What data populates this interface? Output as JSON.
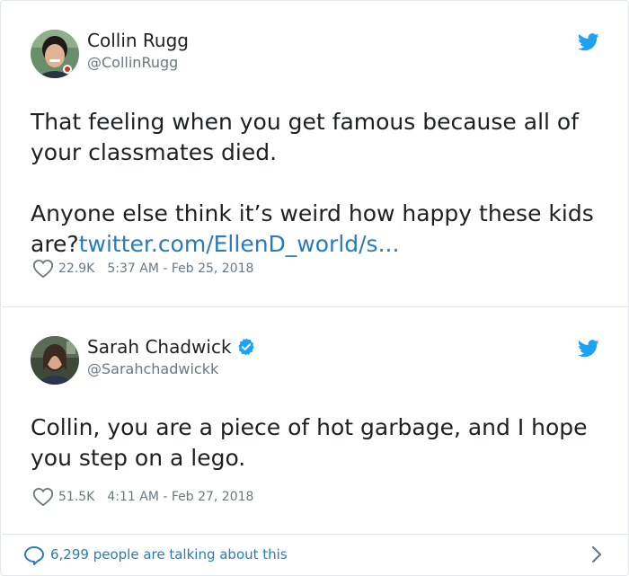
{
  "tweets": [
    {
      "name": "Collin Rugg",
      "handle": "@CollinRugg",
      "verified": false,
      "text_part1": "That feeling when you get famous because all of your classmates died.\n\nAnyone else think it’s weird how happy these kids are?",
      "link": "twitter.com/EllenD_world/s...",
      "likes": "22.9K",
      "timestamp": "5:37 AM - Feb 25, 2018"
    },
    {
      "name": "Sarah Chadwick",
      "handle": "@Sarahchadwickk",
      "verified": true,
      "text_part1": "Collin, you are a piece of hot garbage, and I hope you step on a lego.",
      "likes": "51.5K",
      "timestamp": "4:11 AM - Feb 27, 2018"
    }
  ],
  "footer": {
    "talking_text": "6,299 people are talking about this"
  },
  "colors": {
    "twitter_blue": "#1da1f2",
    "link_blue": "#2b7bb9",
    "meta_gray": "#697882",
    "text_dark": "#1c2022",
    "border": "#e1e8ed"
  },
  "icons": {
    "brand": "twitter-bird-icon",
    "like": "heart-outline-icon",
    "verified": "verified-badge-icon",
    "conversation": "speech-bubble-icon",
    "more": "chevron-right-icon"
  }
}
